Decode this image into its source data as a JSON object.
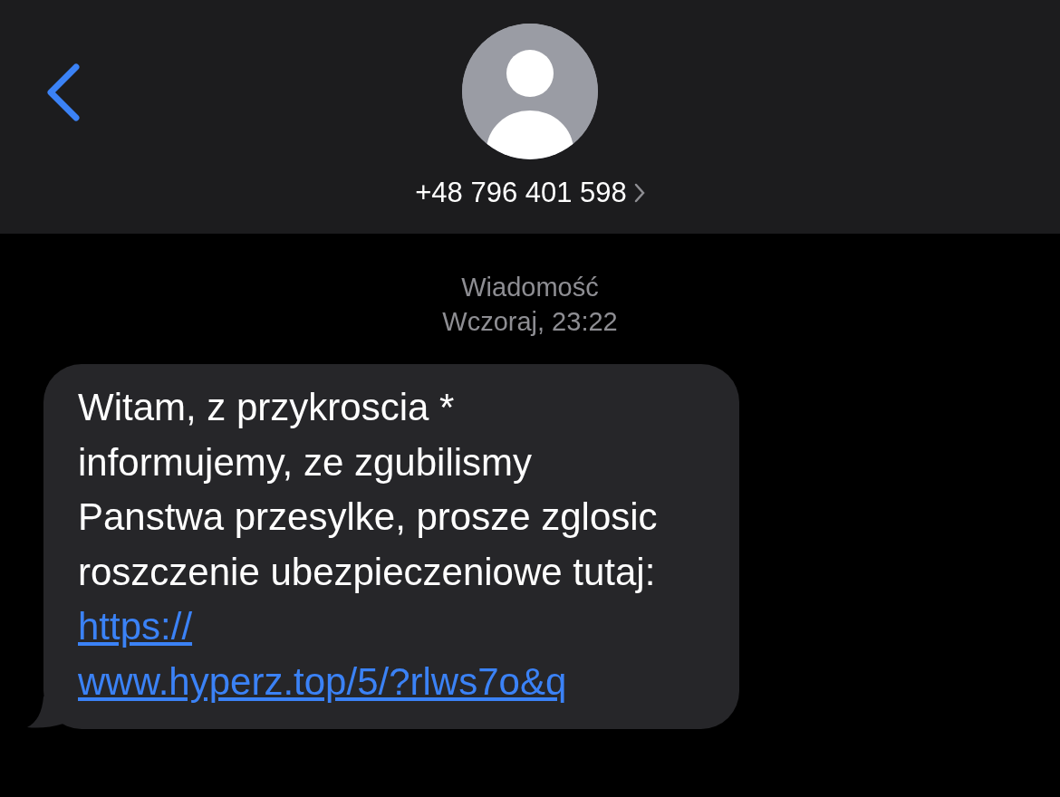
{
  "header": {
    "contact": "+48 796 401 598"
  },
  "thread": {
    "label": "Wiadomość",
    "time": "Wczoraj, 23:22"
  },
  "messages": [
    {
      "text": "Witam, z przykroscia * informujemy, ze zgubilismy Panstwa przesylke, prosze zglosic roszczenie ubezpieczeniowe tutaj:",
      "link_lines": [
        "https://",
        "www.hyperz.top/5/?rlws7o&q"
      ]
    }
  ]
}
